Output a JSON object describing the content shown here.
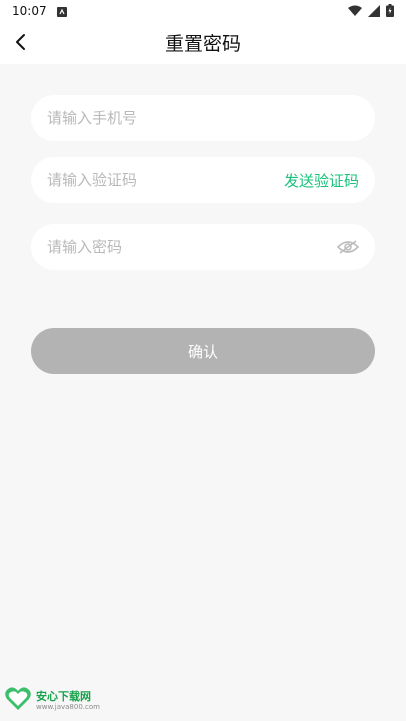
{
  "status_bar": {
    "time": "10:07",
    "icons": [
      "wifi-icon",
      "cell-signal-icon",
      "battery-icon"
    ]
  },
  "header": {
    "title": "重置密码",
    "back_icon": "chevron-left-icon"
  },
  "form": {
    "phone": {
      "placeholder": "请输入手机号",
      "value": ""
    },
    "code": {
      "placeholder": "请输入验证码",
      "value": "",
      "send_label": "发送验证码"
    },
    "password": {
      "placeholder": "请输入密码",
      "value": "",
      "toggle_icon": "eye-off-icon"
    },
    "confirm_label": "确认"
  },
  "watermark": {
    "title": "安心下载网",
    "url": "www.java800.com"
  },
  "colors": {
    "accent": "#19c27a",
    "button_disabled": "#b3b3b3",
    "background": "#f7f7f7"
  }
}
